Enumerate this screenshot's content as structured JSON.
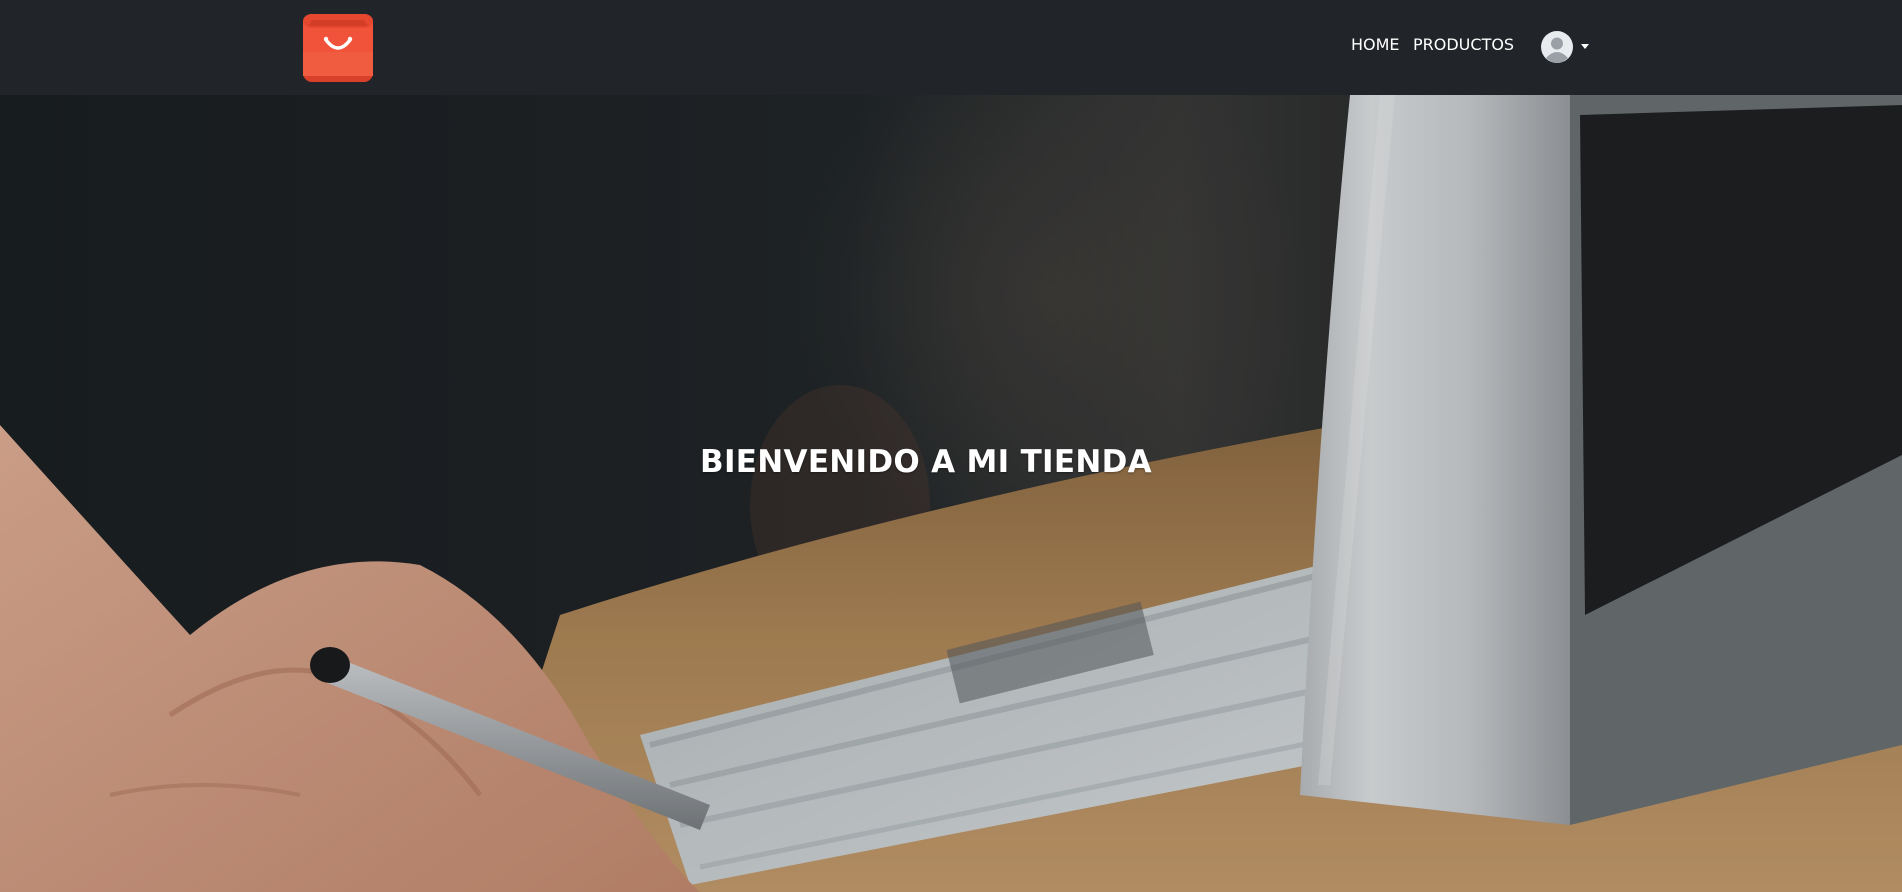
{
  "navbar": {
    "brand": {
      "icon": "shopping-bag-icon",
      "color": "#f0533a"
    },
    "links": [
      {
        "label": "HOME"
      },
      {
        "label": "PRODUCTOS"
      }
    ],
    "user_menu": {
      "icon": "user-avatar-icon",
      "caret": "caret-down-icon"
    },
    "background": "#212529"
  },
  "hero": {
    "title": "BIENVENIDO A MI TIENDA",
    "image": "workspace-photo"
  },
  "colors": {
    "accent": "#f0533a",
    "text": "#ffffff"
  }
}
